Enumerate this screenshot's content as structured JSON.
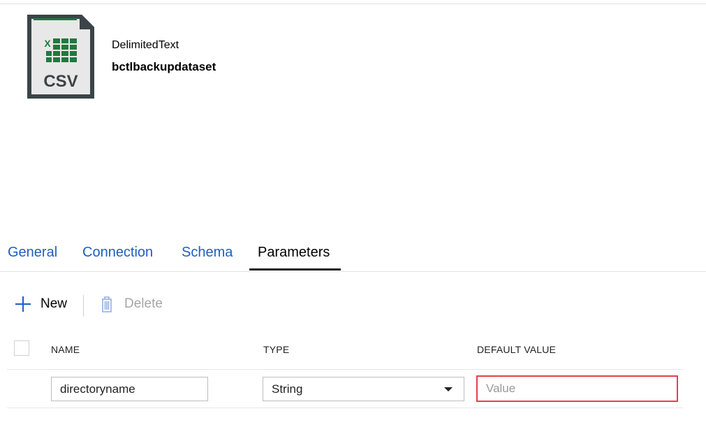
{
  "dataset": {
    "icon": "csv-file-icon",
    "icon_format_text": "CSV",
    "icon_app_text": "X",
    "type": "DelimitedText",
    "name": "bctlbackupdataset",
    "colors": {
      "icon_body": "#e8e8e8",
      "icon_border": "#3b4448",
      "excel_green": "#1f7a3e"
    }
  },
  "tabs": [
    {
      "label": "General",
      "active": false
    },
    {
      "label": "Connection",
      "active": false
    },
    {
      "label": "Schema",
      "active": false
    },
    {
      "label": "Parameters",
      "active": true
    }
  ],
  "toolbar": {
    "new_label": "New",
    "new_icon": "plus-icon",
    "delete_label": "Delete",
    "delete_icon": "trash-icon",
    "delete_disabled": true
  },
  "table": {
    "columns": [
      "NAME",
      "TYPE",
      "DEFAULT VALUE"
    ],
    "rows": [
      {
        "name": "directoryname",
        "type": "String",
        "default_value": "",
        "default_placeholder": "Value"
      }
    ]
  },
  "colors": {
    "link_blue": "#1d5fbf",
    "error_red": "#e5404b",
    "disabled_gray": "#a6a6a6"
  }
}
